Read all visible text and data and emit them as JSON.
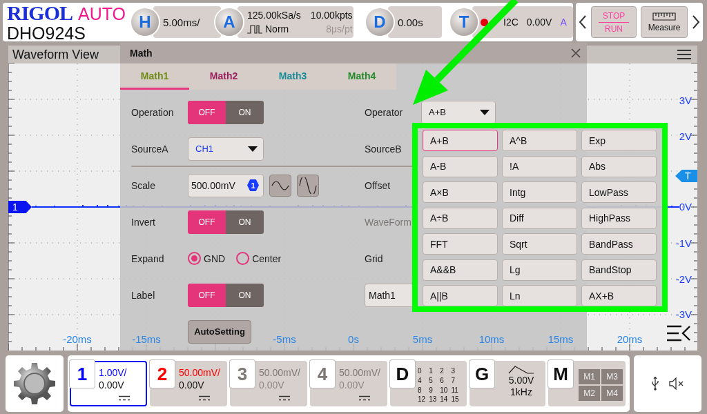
{
  "header": {
    "brand": "RIGOL",
    "mode": "AUTO",
    "model": "DHO924S"
  },
  "horizontal": {
    "key": "H",
    "scale": "5.00ms/"
  },
  "acquire": {
    "key": "A",
    "sample_rate": "125.00kSa/s",
    "memory_depth": "10.00kpts",
    "mode": "Norm",
    "time_per_point": "8μs/pt"
  },
  "delay": {
    "key": "D",
    "value": "0.00s"
  },
  "trigger": {
    "key": "T",
    "type": "I2C",
    "level": "0.00V",
    "source": "A"
  },
  "run_stop": {
    "stop": "STOP",
    "run": "RUN"
  },
  "measure": {
    "label": "Measure"
  },
  "waveform_view": {
    "title": "Waveform View",
    "channel_marker": "1",
    "trigger_marker": "T",
    "y_labels": [
      "3V",
      "2V",
      "0V",
      "-1V",
      "-2V",
      "-3V"
    ],
    "x_labels": [
      "-20ms",
      "-15ms",
      "-5ms",
      "0s",
      "5ms",
      "10ms",
      "15ms",
      "20ms"
    ]
  },
  "math_dialog": {
    "title": "Math",
    "tabs": [
      {
        "label": "Math1",
        "selected": true,
        "color": "#6e8a14"
      },
      {
        "label": "Math2",
        "selected": false,
        "color": "#9c1c5c"
      },
      {
        "label": "Math3",
        "selected": false,
        "color": "#178c98"
      },
      {
        "label": "Math4",
        "selected": false,
        "color": "#23892a"
      }
    ],
    "left_rows": [
      {
        "kind": "toggle",
        "label": "Operation",
        "off_label": "OFF",
        "on_label": "ON",
        "on": false
      },
      {
        "kind": "source",
        "label": "SourceA",
        "value": "CH1"
      },
      {
        "kind": "scale",
        "label": "Scale",
        "value": "500.00mV",
        "badge": "1"
      },
      {
        "kind": "toggle",
        "label": "Invert",
        "off_label": "OFF",
        "on_label": "ON",
        "on": false
      },
      {
        "kind": "radio",
        "label": "Expand",
        "options": [
          {
            "label": "GND",
            "selected": true
          },
          {
            "label": "Center",
            "selected": false
          }
        ]
      },
      {
        "kind": "toggle",
        "label": "Label",
        "off_label": "OFF",
        "on_label": "ON",
        "on": false
      },
      {
        "kind": "button",
        "label": "AutoSetting"
      }
    ],
    "right_rows": [
      {
        "kind": "dropdown",
        "label": "Operator",
        "value": "A+B"
      },
      {
        "kind": "label",
        "label": "SourceB",
        "disabled": false
      },
      {
        "kind": "label",
        "label": "Offset",
        "disabled": false
      },
      {
        "kind": "label",
        "label": "WaveForm",
        "disabled": true
      },
      {
        "kind": "label",
        "label": "Grid",
        "disabled": false
      },
      {
        "kind": "field",
        "value": "Math1"
      }
    ]
  },
  "operator_menu": {
    "options": [
      {
        "label": "A+B",
        "selected": true
      },
      {
        "label": "A^B",
        "selected": false
      },
      {
        "label": "Exp",
        "selected": false
      },
      {
        "label": "A-B",
        "selected": false
      },
      {
        "label": "!A",
        "selected": false
      },
      {
        "label": "Abs",
        "selected": false
      },
      {
        "label": "A×B",
        "selected": false
      },
      {
        "label": "Intg",
        "selected": false
      },
      {
        "label": "LowPass",
        "selected": false
      },
      {
        "label": "A÷B",
        "selected": false
      },
      {
        "label": "Diff",
        "selected": false
      },
      {
        "label": "HighPass",
        "selected": false
      },
      {
        "label": "FFT",
        "selected": false
      },
      {
        "label": "Sqrt",
        "selected": false
      },
      {
        "label": "BandPass",
        "selected": false
      },
      {
        "label": "A&&B",
        "selected": false
      },
      {
        "label": "Lg",
        "selected": false
      },
      {
        "label": "BandStop",
        "selected": false
      },
      {
        "label": "A||B",
        "selected": false
      },
      {
        "label": "Ln",
        "selected": false
      },
      {
        "label": "AX+B",
        "selected": false
      }
    ]
  },
  "annotation": {
    "arrow": true,
    "highlight_frame": true
  },
  "channels": [
    {
      "number": "1",
      "scale": "1.00V/",
      "offset": "0.00V",
      "color": "#0000ff",
      "enabled": true,
      "selected": true
    },
    {
      "number": "2",
      "scale": "50.00mV/",
      "offset": "0.00V",
      "color": "#ff0000",
      "enabled": true,
      "selected": false
    },
    {
      "number": "3",
      "scale": "50.00mV/",
      "offset": "0.00V",
      "color": "#7f7773",
      "enabled": false,
      "selected": false
    },
    {
      "number": "4",
      "scale": "50.00mV/",
      "offset": "0.00V",
      "color": "#7f7773",
      "enabled": false,
      "selected": false
    }
  ],
  "digital": {
    "key": "D",
    "channels": [
      "0",
      "1",
      "2",
      "3",
      "4",
      "5",
      "6",
      "7",
      "8",
      "9",
      "10",
      "11",
      "12",
      "13",
      "14",
      "15"
    ]
  },
  "generator": {
    "key": "G",
    "amplitude": "5.00V",
    "frequency": "1kHz"
  },
  "memory": {
    "key": "M",
    "slots": [
      "M1",
      "M3",
      "M2",
      "M4"
    ]
  }
}
